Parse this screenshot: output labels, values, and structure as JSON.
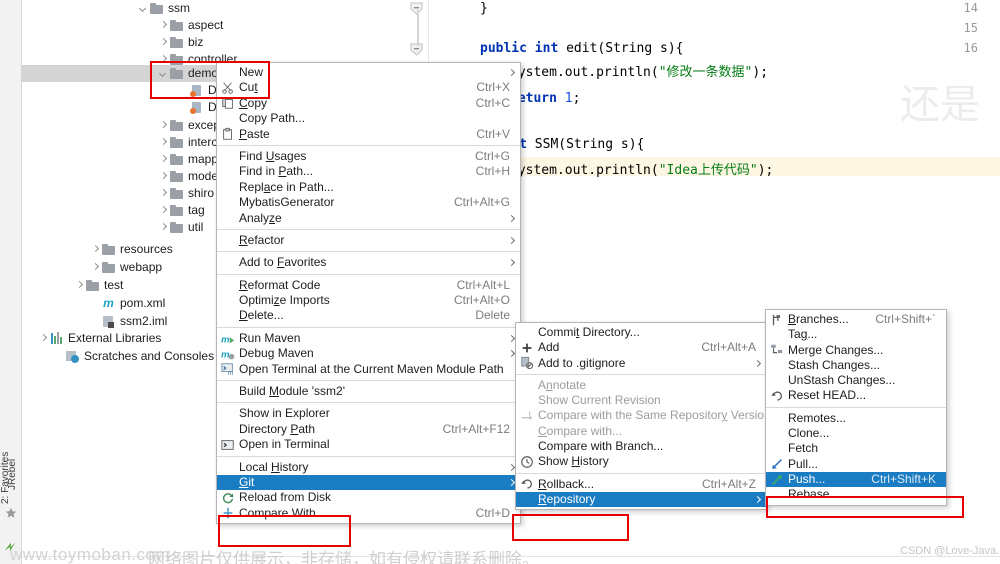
{
  "toolstrip": {
    "items": [
      {
        "label": "2: Favorites",
        "icon": "star-icon"
      },
      {
        "label": "JRebel",
        "icon": "jrebel-icon"
      }
    ]
  },
  "project_tree": {
    "rows": [
      {
        "label": "ssm",
        "icon": "folder-icon",
        "indent": 116,
        "arrow": "open",
        "selected": false
      },
      {
        "label": "aspect",
        "icon": "folder-icon",
        "indent": 136,
        "arrow": "closed",
        "selected": false
      },
      {
        "label": "biz",
        "icon": "folder-icon",
        "indent": 136,
        "arrow": "closed",
        "selected": false
      },
      {
        "label": "controller",
        "icon": "folder-icon",
        "indent": 136,
        "arrow": "closed",
        "selected": false
      },
      {
        "label": "demo",
        "icon": "folder-icon",
        "indent": 136,
        "arrow": "open",
        "selected": true
      },
      {
        "label": "Demo",
        "icon": "java-class-icon",
        "indent": 156,
        "arrow": "none",
        "selected": false
      },
      {
        "label": "Demo",
        "icon": "java-class-icon",
        "indent": 156,
        "arrow": "none",
        "selected": false
      },
      {
        "label": "exception",
        "icon": "folder-icon",
        "indent": 136,
        "arrow": "closed",
        "selected": false
      },
      {
        "label": "interceptor",
        "icon": "folder-icon",
        "indent": 136,
        "arrow": "closed",
        "selected": false
      },
      {
        "label": "mapper",
        "icon": "folder-icon",
        "indent": 136,
        "arrow": "closed",
        "selected": false
      },
      {
        "label": "model",
        "icon": "folder-icon",
        "indent": 136,
        "arrow": "closed",
        "selected": false
      },
      {
        "label": "shiro",
        "icon": "folder-icon",
        "indent": 136,
        "arrow": "closed",
        "selected": false
      },
      {
        "label": "tag",
        "icon": "folder-icon",
        "indent": 136,
        "arrow": "closed",
        "selected": false
      },
      {
        "label": "util",
        "icon": "folder-icon",
        "indent": 136,
        "arrow": "closed",
        "selected": false
      },
      {
        "label": "resources",
        "icon": "folder-icon",
        "indent": 68,
        "arrow": "closed",
        "selected": false
      },
      {
        "label": "webapp",
        "icon": "folder-icon",
        "indent": 68,
        "arrow": "closed",
        "selected": false
      },
      {
        "label": "test",
        "icon": "folder-icon",
        "indent": 52,
        "arrow": "closed",
        "selected": false
      },
      {
        "label": "pom.xml",
        "icon": "maven-icon",
        "indent": 68,
        "arrow": "none",
        "selected": false
      },
      {
        "label": "ssm2.iml",
        "icon": "iml-icon",
        "indent": 68,
        "arrow": "none",
        "selected": false
      },
      {
        "label": "External Libraries",
        "icon": "library-icon",
        "indent": 16,
        "arrow": "closed",
        "selected": false
      },
      {
        "label": "Scratches and Consoles",
        "icon": "scratches-icon",
        "indent": 32,
        "arrow": "none",
        "selected": false
      }
    ]
  },
  "editor": {
    "line_numbers": [
      "14",
      "15",
      "16"
    ],
    "code_lines": [
      {
        "parts": [
          {
            "t": "}",
            "c": "plain"
          }
        ]
      },
      {
        "parts": []
      },
      {
        "parts": [
          {
            "t": "public",
            "c": "kw"
          },
          {
            "t": " ",
            "c": "plain"
          },
          {
            "t": "int",
            "c": "kw"
          },
          {
            "t": " edit(String s){",
            "c": "plain"
          }
        ]
      },
      {
        "parts": [
          {
            "t": "System.out.println(",
            "c": "plain"
          },
          {
            "t": "\"修改一条数据\"",
            "c": "str"
          },
          {
            "t": ");",
            "c": "plain"
          }
        ]
      },
      {
        "parts": [
          {
            "t": "return",
            "c": "kw"
          },
          {
            "t": " ",
            "c": "plain"
          },
          {
            "t": "1",
            "c": "num"
          },
          {
            "t": ";",
            "c": "plain"
          }
        ]
      },
      {
        "parts": [
          {
            "t": "ic",
            "c": "kw"
          },
          {
            "t": " ",
            "c": "plain"
          },
          {
            "t": "int",
            "c": "kw"
          },
          {
            "t": " SSM(String s){",
            "c": "plain"
          }
        ]
      },
      {
        "parts": [
          {
            "t": "System.out.println(",
            "c": "plain"
          },
          {
            "t": "\"Idea上传代码\"",
            "c": "str"
          },
          {
            "t": ");",
            "c": "plain"
          }
        ]
      }
    ]
  },
  "context_menu": {
    "name": "project-context-menu",
    "items": [
      {
        "label": "New",
        "accel": "",
        "icon": "",
        "submenu": true,
        "mnemonic": ""
      },
      {
        "label": "Cut",
        "accel": "Ctrl+X",
        "icon": "scissors-icon",
        "submenu": false,
        "mnemonic": "t"
      },
      {
        "label": "Copy",
        "accel": "Ctrl+C",
        "icon": "copy-icon",
        "submenu": false,
        "mnemonic": "C"
      },
      {
        "label": "Copy Path...",
        "accel": "",
        "icon": "",
        "submenu": false,
        "mnemonic": ""
      },
      {
        "label": "Paste",
        "accel": "Ctrl+V",
        "icon": "paste-icon",
        "submenu": false,
        "mnemonic": "P"
      },
      {
        "separator": true
      },
      {
        "label": "Find Usages",
        "accel": "Ctrl+G",
        "icon": "",
        "submenu": false,
        "mnemonic": "U"
      },
      {
        "label": "Find in Path...",
        "accel": "Ctrl+H",
        "icon": "",
        "submenu": false,
        "mnemonic": "P"
      },
      {
        "label": "Replace in Path...",
        "accel": "",
        "icon": "",
        "submenu": false,
        "mnemonic": "a"
      },
      {
        "label": "MybatisGenerator",
        "accel": "Ctrl+Alt+G",
        "icon": "",
        "submenu": false,
        "mnemonic": ""
      },
      {
        "label": "Analyze",
        "accel": "",
        "icon": "",
        "submenu": true,
        "mnemonic": "z"
      },
      {
        "separator": true
      },
      {
        "label": "Refactor",
        "accel": "",
        "icon": "",
        "submenu": true,
        "mnemonic": "R"
      },
      {
        "separator": true
      },
      {
        "label": "Add to Favorites",
        "accel": "",
        "icon": "",
        "submenu": true,
        "mnemonic": "F"
      },
      {
        "separator": true
      },
      {
        "label": "Reformat Code",
        "accel": "Ctrl+Alt+L",
        "icon": "",
        "submenu": false,
        "mnemonic": "R"
      },
      {
        "label": "Optimize Imports",
        "accel": "Ctrl+Alt+O",
        "icon": "",
        "submenu": false,
        "mnemonic": "z"
      },
      {
        "label": "Delete...",
        "accel": "Delete",
        "icon": "",
        "submenu": false,
        "mnemonic": "D"
      },
      {
        "separator": true
      },
      {
        "label": "Run Maven",
        "accel": "",
        "icon": "maven-run-icon",
        "submenu": true,
        "mnemonic": ""
      },
      {
        "label": "Debug Maven",
        "accel": "",
        "icon": "maven-debug-icon",
        "submenu": true,
        "mnemonic": ""
      },
      {
        "label": "Open Terminal at the Current Maven Module Path",
        "accel": "",
        "icon": "terminal-maven-icon",
        "submenu": false,
        "mnemonic": ""
      },
      {
        "separator": true
      },
      {
        "label": "Build Module 'ssm2'",
        "accel": "",
        "icon": "",
        "submenu": false,
        "mnemonic": "M"
      },
      {
        "separator": true
      },
      {
        "label": "Show in Explorer",
        "accel": "",
        "icon": "",
        "submenu": false,
        "mnemonic": ""
      },
      {
        "label": "Directory Path",
        "accel": "Ctrl+Alt+F12",
        "icon": "",
        "submenu": false,
        "mnemonic": "P"
      },
      {
        "label": "Open in Terminal",
        "accel": "",
        "icon": "terminal-icon",
        "submenu": false,
        "mnemonic": ""
      },
      {
        "separator": true
      },
      {
        "label": "Local History",
        "accel": "",
        "icon": "",
        "submenu": true,
        "mnemonic": "H"
      },
      {
        "label": "Git",
        "accel": "",
        "icon": "",
        "submenu": true,
        "selected": true,
        "mnemonic": "G"
      },
      {
        "label": "Reload from Disk",
        "accel": "",
        "icon": "reload-icon",
        "submenu": false,
        "mnemonic": ""
      },
      {
        "label": "Compare With...",
        "accel": "Ctrl+D",
        "icon": "compare-icon",
        "submenu": false,
        "mnemonic": ""
      }
    ]
  },
  "git_menu": {
    "name": "git-submenu",
    "items": [
      {
        "label": "Commit Directory...",
        "accel": "",
        "icon": "",
        "submenu": false,
        "mnemonic": "t"
      },
      {
        "label": "Add",
        "accel": "Ctrl+Alt+A",
        "icon": "plus-icon",
        "submenu": false,
        "mnemonic": ""
      },
      {
        "label": "Add to .gitignore",
        "accel": "",
        "icon": "gitignore-icon",
        "submenu": true,
        "mnemonic": ""
      },
      {
        "separator": true
      },
      {
        "label": "Annotate",
        "accel": "",
        "icon": "",
        "submenu": false,
        "disabled": true,
        "mnemonic": "n"
      },
      {
        "label": "Show Current Revision",
        "accel": "",
        "icon": "",
        "submenu": false,
        "disabled": true,
        "mnemonic": ""
      },
      {
        "label": "Compare with the Same Repository Version",
        "accel": "",
        "icon": "compare-repo-icon",
        "submenu": false,
        "disabled": true,
        "mnemonic": "y"
      },
      {
        "label": "Compare with...",
        "accel": "",
        "icon": "",
        "submenu": false,
        "disabled": true,
        "mnemonic": "C"
      },
      {
        "label": "Compare with Branch...",
        "accel": "",
        "icon": "",
        "submenu": false,
        "mnemonic": ""
      },
      {
        "label": "Show History",
        "accel": "",
        "icon": "clock-icon",
        "submenu": false,
        "mnemonic": "H"
      },
      {
        "separator": true
      },
      {
        "label": "Rollback...",
        "accel": "Ctrl+Alt+Z",
        "icon": "rollback-icon",
        "submenu": false,
        "mnemonic": "R"
      },
      {
        "label": "Repository",
        "accel": "",
        "icon": "",
        "submenu": true,
        "selected": true,
        "mnemonic": "R"
      }
    ]
  },
  "repository_menu": {
    "name": "repository-submenu",
    "items": [
      {
        "label": "Branches...",
        "accel": "Ctrl+Shift+`",
        "icon": "branch-icon",
        "submenu": false,
        "mnemonic": "B"
      },
      {
        "label": "Tag...",
        "accel": "",
        "icon": "",
        "submenu": false,
        "mnemonic": "g"
      },
      {
        "label": "Merge Changes...",
        "accel": "",
        "icon": "merge-icon",
        "submenu": false,
        "mnemonic": ""
      },
      {
        "label": "Stash Changes...",
        "accel": "",
        "icon": "",
        "submenu": false,
        "mnemonic": ""
      },
      {
        "label": "UnStash Changes...",
        "accel": "",
        "icon": "",
        "submenu": false,
        "mnemonic": ""
      },
      {
        "label": "Reset HEAD...",
        "accel": "",
        "icon": "reset-icon",
        "submenu": false,
        "mnemonic": ""
      },
      {
        "separator": true
      },
      {
        "label": "Remotes...",
        "accel": "",
        "icon": "",
        "submenu": false,
        "mnemonic": ""
      },
      {
        "label": "Clone...",
        "accel": "",
        "icon": "",
        "submenu": false,
        "mnemonic": ""
      },
      {
        "label": "Fetch",
        "accel": "",
        "icon": "",
        "submenu": false,
        "mnemonic": ""
      },
      {
        "label": "Pull...",
        "accel": "",
        "icon": "pull-arrow-icon",
        "submenu": false,
        "mnemonic": ""
      },
      {
        "label": "Push...",
        "accel": "Ctrl+Shift+K",
        "icon": "push-arrow-icon",
        "submenu": false,
        "selected": true,
        "mnemonic": ""
      },
      {
        "label": "Rebase...",
        "accel": "",
        "icon": "",
        "submenu": false,
        "mnemonic": ""
      }
    ]
  },
  "watermarks": {
    "bottom_url": "www.toymoban.com",
    "bottom_cn": "网络图片仅供展示，非存储，如有侵权请联系删除。",
    "csdn": "CSDN @Love-Java.",
    "big_cn": "还是"
  },
  "colors": {
    "menu_selection": "#1a7dc4",
    "annotation_red": "#e60000",
    "tree_selection": "#d4d4d4",
    "keyword_blue": "#0033b3",
    "string_green": "#067d17"
  }
}
